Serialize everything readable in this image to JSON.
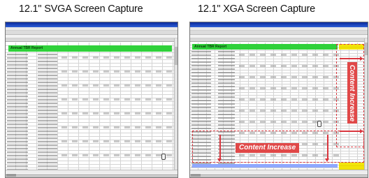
{
  "captions": {
    "left": "12.1\" SVGA Screen Capture",
    "right": "12.1\" XGA Screen Capture"
  },
  "left_screen": {
    "sheet_title": "Annual TBR Report"
  },
  "right_screen": {
    "sheet_title": "Annual TBR Report"
  },
  "annotations": {
    "horizontal_label": "Content Increase",
    "vertical_label": "Content Increase"
  },
  "colors": {
    "banner_green": "#2fd13a",
    "annotation_red": "#d9363e",
    "highlight_yellow": "#f2e40b",
    "title_bar_blue": "#0a2a9c"
  }
}
